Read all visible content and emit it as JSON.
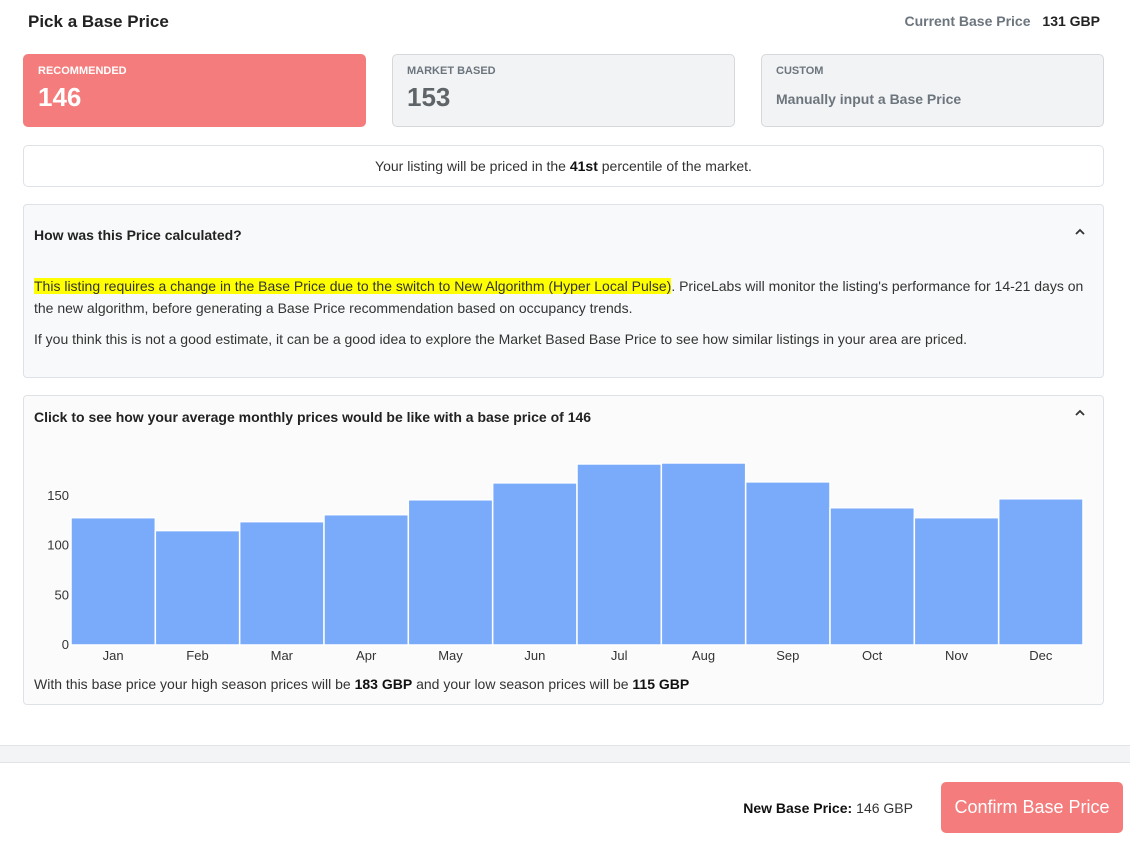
{
  "header": {
    "title": "Pick a Base Price",
    "current_label": "Current Base Price",
    "current_value": "131 GBP"
  },
  "cards": {
    "recommended": {
      "title": "RECOMMENDED",
      "value": "146",
      "active": true
    },
    "market": {
      "title": "MARKET BASED",
      "value": "153"
    },
    "custom": {
      "title": "CUSTOM",
      "text": "Manually input a Base Price"
    }
  },
  "percentile": {
    "prefix": "Your listing will be priced in the",
    "value": "41st",
    "suffix": "percentile of the market."
  },
  "calc_panel": {
    "header": "How was this Price calculated?",
    "highlight": "This listing requires a change in the Base Price due to the switch to New Algorithm (Hyper Local Pulse)",
    "p1_rest": ". PriceLabs will monitor the listing's performance for 14-21 days on the new algorithm, before generating a Base Price recommendation based on occupancy trends.",
    "p2": "If you think this is not a good estimate, it can be a good idea to explore the Market Based Base Price to see how similar listings in your area are priced."
  },
  "chart_panel": {
    "header": "Click to see how your average monthly prices would be like with a base price of 146",
    "summary_prefix": "With this base price your high season prices will be",
    "high_value": "183 GBP",
    "summary_mid": "and your low season prices will be",
    "low_value": "115 GBP"
  },
  "chart_data": {
    "type": "bar",
    "categories": [
      "Jan",
      "Feb",
      "Mar",
      "Apr",
      "May",
      "Jun",
      "Jul",
      "Aug",
      "Sep",
      "Oct",
      "Nov",
      "Dec"
    ],
    "values": [
      128,
      115,
      124,
      131,
      146,
      163,
      182,
      183,
      164,
      138,
      128,
      147
    ],
    "yticks": [
      0,
      50,
      100,
      150
    ],
    "ylim": [
      0,
      190
    ],
    "bar_color": "#7aaafa"
  },
  "footer": {
    "new_price_label": "New Base Price:",
    "new_price_value": "146 GBP",
    "confirm_label": "Confirm Base Price"
  },
  "colors": {
    "accent": "#f47c7c",
    "highlight": "#ffff00"
  },
  "icons": {
    "collapse": "chevron-up-icon"
  }
}
